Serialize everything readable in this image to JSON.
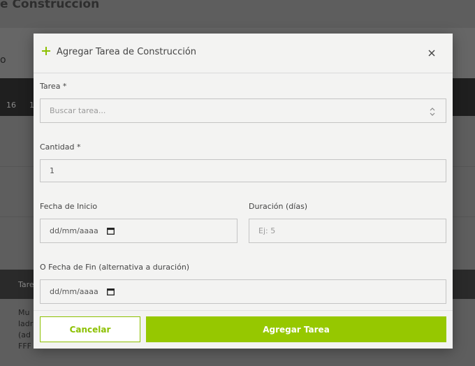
{
  "background": {
    "title_fragment": "e Construcción",
    "mark": "o",
    "day_numbers": [
      "16",
      "1"
    ],
    "table_header": "Tare",
    "cell_lines": [
      "Mu",
      "ladr",
      "(ad",
      "FFF"
    ]
  },
  "modal": {
    "title": "Agregar Tarea de Construcción",
    "fields": {
      "tarea": {
        "label": "Tarea *",
        "placeholder": "Buscar tarea..."
      },
      "cantidad": {
        "label": "Cantidad *",
        "value": "1"
      },
      "fecha_inicio": {
        "label": "Fecha de Inicio",
        "value": "dd/mm/aaaa"
      },
      "duracion": {
        "label": "Duración (días)",
        "placeholder": "Ej: 5"
      },
      "fecha_fin": {
        "label": "O Fecha de Fin (alternativa a duración)",
        "value": "dd/mm/aaaa"
      }
    },
    "buttons": {
      "cancel": "Cancelar",
      "submit": "Agregar Tarea"
    }
  },
  "icons": [
    "plus-icon",
    "close-icon",
    "chevron-up-down-icon",
    "calendar-icon"
  ],
  "colors": {
    "accent": "#96c800",
    "accent_border": "#8cc000"
  }
}
